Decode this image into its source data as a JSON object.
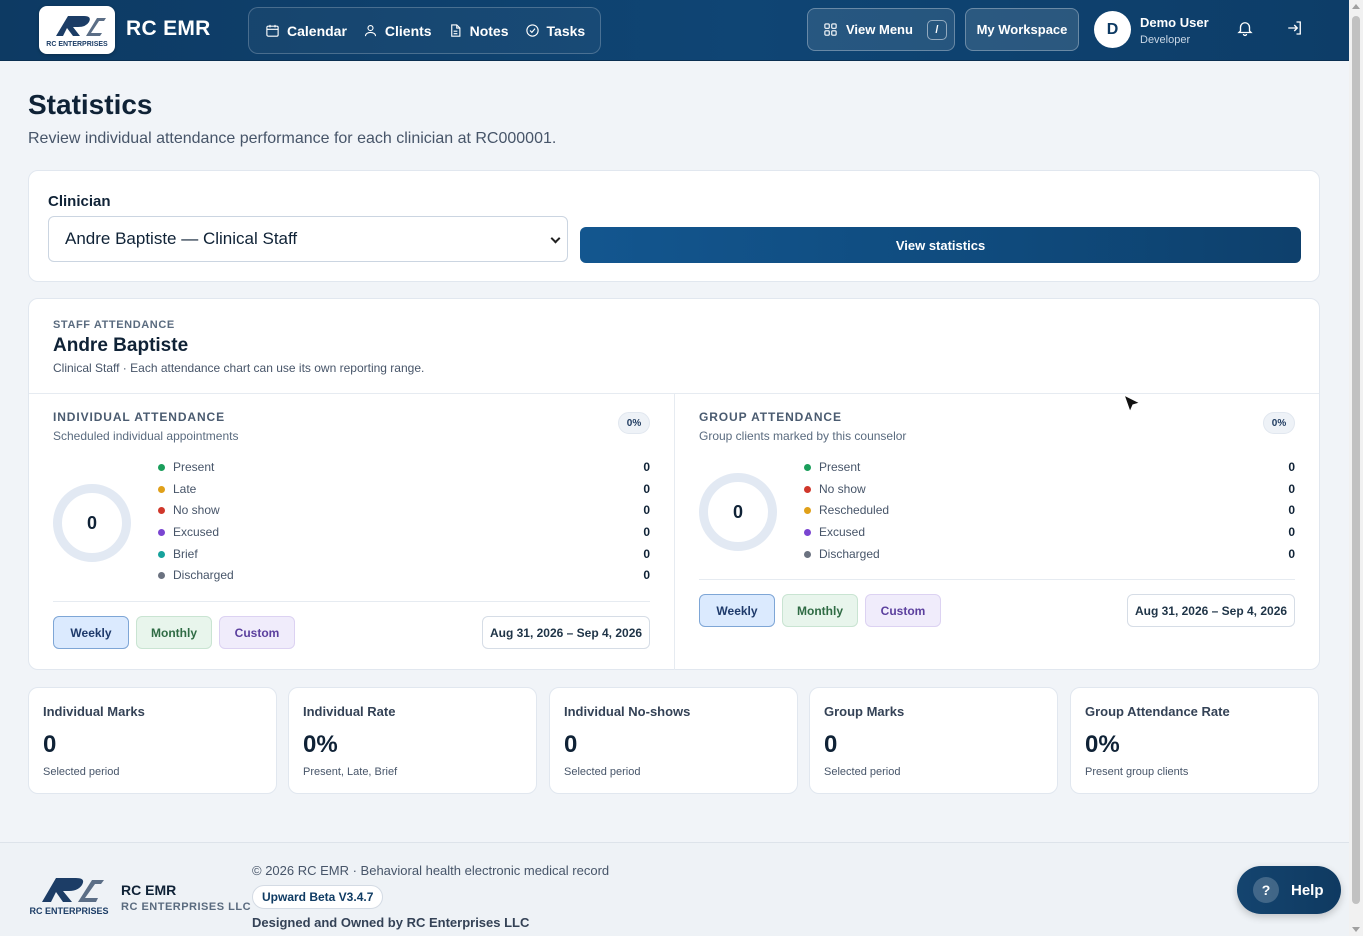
{
  "app": {
    "title": "RC EMR",
    "logo_text": "RC ENTERPRISES"
  },
  "nav": {
    "items": [
      {
        "label": "Calendar",
        "icon": "calendar-icon"
      },
      {
        "label": "Clients",
        "icon": "user-icon"
      },
      {
        "label": "Notes",
        "icon": "document-icon"
      },
      {
        "label": "Tasks",
        "icon": "check-circle-icon"
      }
    ],
    "view_menu_label": "View Menu",
    "view_menu_shortcut": "/",
    "workspace_label": "My Workspace"
  },
  "user": {
    "initial": "D",
    "name": "Demo User",
    "role": "Developer"
  },
  "page": {
    "title": "Statistics",
    "subtitle": "Review individual attendance performance for each clinician at RC000001."
  },
  "clinician_form": {
    "label": "Clinician",
    "selected": "Andre Baptiste — Clinical Staff",
    "submit_label": "View statistics"
  },
  "staff_attendance": {
    "eyebrow": "STAFF ATTENDANCE",
    "name": "Andre Baptiste",
    "description": "Clinical Staff · Each attendance chart can use its own reporting range.",
    "individual": {
      "title": "INDIVIDUAL ATTENDANCE",
      "subtitle": "Scheduled individual appointments",
      "percent": "0%",
      "total": "0",
      "legend": [
        {
          "label": "Present",
          "value": "0",
          "color": "#1a9e5b"
        },
        {
          "label": "Late",
          "value": "0",
          "color": "#e0a019"
        },
        {
          "label": "No show",
          "value": "0",
          "color": "#d0372b"
        },
        {
          "label": "Excused",
          "value": "0",
          "color": "#7a45d1"
        },
        {
          "label": "Brief",
          "value": "0",
          "color": "#17a29c"
        },
        {
          "label": "Discharged",
          "value": "0",
          "color": "#6b7280"
        }
      ],
      "ranges": [
        "Weekly",
        "Monthly",
        "Custom"
      ],
      "active_range": "Weekly",
      "date_range": "Aug 31, 2026 – Sep 4, 2026"
    },
    "group": {
      "title": "GROUP ATTENDANCE",
      "subtitle": "Group clients marked by this counselor",
      "percent": "0%",
      "total": "0",
      "legend": [
        {
          "label": "Present",
          "value": "0",
          "color": "#1a9e5b"
        },
        {
          "label": "No show",
          "value": "0",
          "color": "#d0372b"
        },
        {
          "label": "Rescheduled",
          "value": "0",
          "color": "#e0a019"
        },
        {
          "label": "Excused",
          "value": "0",
          "color": "#7a45d1"
        },
        {
          "label": "Discharged",
          "value": "0",
          "color": "#6b7280"
        }
      ],
      "ranges": [
        "Weekly",
        "Monthly",
        "Custom"
      ],
      "active_range": "Weekly",
      "date_range": "Aug 31, 2026 – Sep 4, 2026"
    }
  },
  "metrics": [
    {
      "label": "Individual Marks",
      "value": "0",
      "note": "Selected period"
    },
    {
      "label": "Individual Rate",
      "value": "0%",
      "note": "Present, Late, Brief"
    },
    {
      "label": "Individual No-shows",
      "value": "0",
      "note": "Selected period"
    },
    {
      "label": "Group Marks",
      "value": "0",
      "note": "Selected period"
    },
    {
      "label": "Group Attendance Rate",
      "value": "0%",
      "note": "Present group clients"
    }
  ],
  "footer": {
    "brand": "RC EMR",
    "company": "RC ENTERPRISES LLC",
    "copyright": "© 2026 RC EMR · Behavioral health electronic medical record",
    "version": "Upward Beta V3.4.7",
    "owned": "Designed and Owned by RC Enterprises LLC"
  },
  "help": {
    "label": "Help",
    "icon_char": "?"
  },
  "colors": {
    "nav_bg": "#0f4574",
    "primary_button": "#13568f",
    "page_bg": "#f1f4f8"
  }
}
